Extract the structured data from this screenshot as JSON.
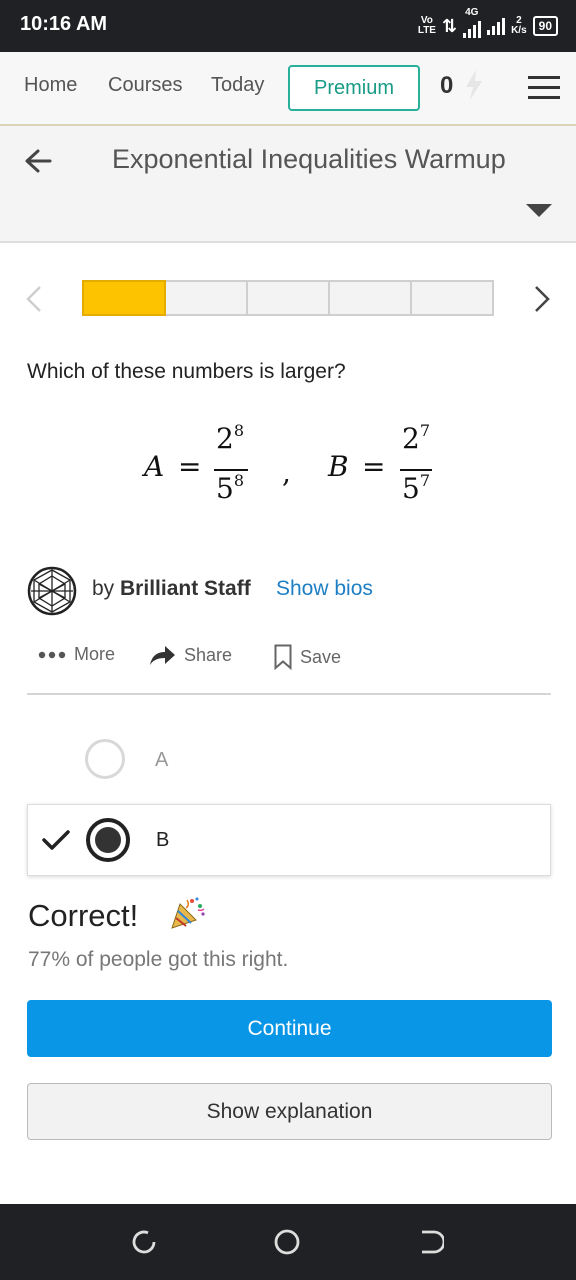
{
  "status_bar": {
    "time": "10:16 AM",
    "network_top": "Vo",
    "network_bottom": "LTE",
    "network_gen": "4G",
    "speed_value": "2",
    "speed_unit": "K/s",
    "battery": "90"
  },
  "nav": {
    "home": "Home",
    "courses": "Courses",
    "today": "Today",
    "premium": "Premium",
    "streak": "0"
  },
  "page": {
    "title": "Exponential Inequalities Warmup"
  },
  "progress": {
    "total_segments": 5,
    "completed_segments": 1,
    "fill_color": "#fdc300"
  },
  "question": {
    "prompt": "Which of these numbers is larger?",
    "formula": {
      "a_var": "A",
      "a_num_base": "2",
      "a_num_exp": "8",
      "a_den_base": "5",
      "a_den_exp": "8",
      "separator": ",",
      "b_var": "B",
      "b_num_base": "2",
      "b_num_exp": "7",
      "b_den_base": "5",
      "b_den_exp": "7",
      "equals": "="
    }
  },
  "author": {
    "by": "by ",
    "name": "Brilliant Staff",
    "show_bios": "Show bios"
  },
  "actions": {
    "more": "More",
    "share": "Share",
    "save": "Save"
  },
  "options": [
    {
      "label": "A",
      "selected": false
    },
    {
      "label": "B",
      "selected": true
    }
  ],
  "result": {
    "title": "Correct!",
    "stat": "77% of people got this right."
  },
  "buttons": {
    "continue": "Continue",
    "show_explanation": "Show explanation"
  },
  "colors": {
    "accent_blue": "#0a96e6",
    "premium_green": "#28b09b",
    "progress_yellow": "#fdc300"
  }
}
